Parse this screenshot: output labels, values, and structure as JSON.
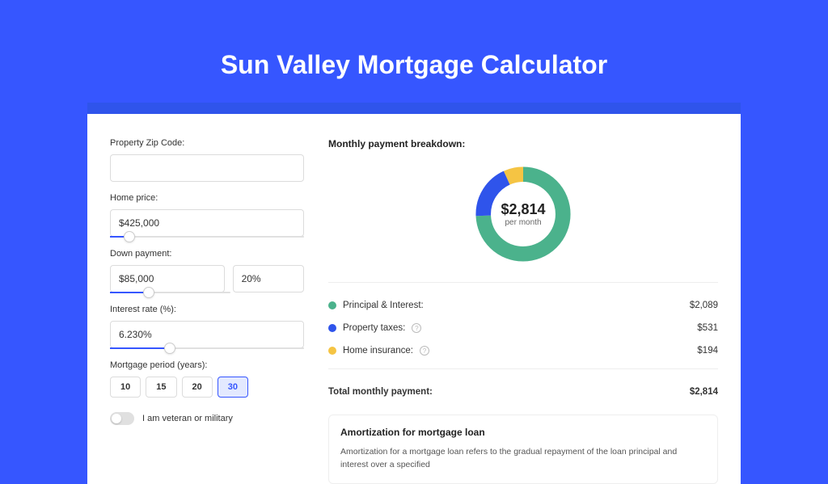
{
  "page_title": "Sun Valley Mortgage Calculator",
  "accent_blue": "#3656ff",
  "form": {
    "zip": {
      "label": "Property Zip Code:",
      "value": ""
    },
    "home_price": {
      "label": "Home price:",
      "value": "$425,000",
      "slider_percent": 10
    },
    "down_payment": {
      "label": "Down payment:",
      "amount": "$85,000",
      "percent": "20%",
      "slider_percent": 20
    },
    "interest_rate": {
      "label": "Interest rate (%):",
      "value": "6.230%",
      "slider_percent": 31
    },
    "mortgage_period": {
      "label": "Mortgage period (years):",
      "options": [
        "10",
        "15",
        "20",
        "30"
      ],
      "selected": "30"
    },
    "veteran": {
      "label": "I am veteran or military",
      "checked": false
    }
  },
  "breakdown": {
    "title": "Monthly payment breakdown:",
    "center_amount": "$2,814",
    "center_sub": "per month",
    "items": [
      {
        "label": "Principal & Interest:",
        "value": "$2,089",
        "color": "#4bb28c",
        "info": false
      },
      {
        "label": "Property taxes:",
        "value": "$531",
        "color": "#2f54eb",
        "info": true
      },
      {
        "label": "Home insurance:",
        "value": "$194",
        "color": "#f5c443",
        "info": true
      }
    ],
    "total": {
      "label": "Total monthly payment:",
      "value": "$2,814"
    }
  },
  "chart_data": {
    "type": "pie",
    "title": "Monthly payment breakdown",
    "series": [
      {
        "name": "Principal & Interest",
        "value": 2089,
        "color": "#4bb28c"
      },
      {
        "name": "Property taxes",
        "value": 531,
        "color": "#2f54eb"
      },
      {
        "name": "Home insurance",
        "value": 194,
        "color": "#f5c443"
      }
    ],
    "total": 2814
  },
  "amortization": {
    "title": "Amortization for mortgage loan",
    "text": "Amortization for a mortgage loan refers to the gradual repayment of the loan principal and interest over a specified"
  }
}
